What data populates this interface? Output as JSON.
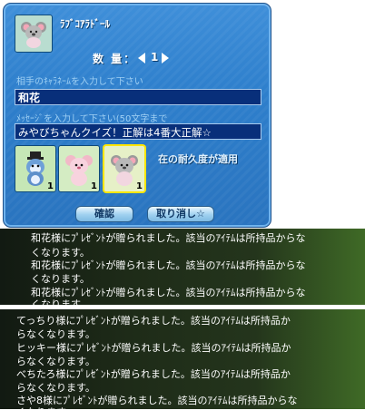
{
  "dialog": {
    "item_name": "ﾗﾌﾞｺｱﾗﾄﾞｰﾙ",
    "quantity_label": "数 量：",
    "quantity_value": "1",
    "hint_recipient": "相手のｷｬﾗﾈｰﾑを入力して下さい",
    "recipient_value": "和花",
    "hint_message": "ﾒｯｾｰｼﾞを入力して下さい(50文字まで",
    "message_value": "みやびちゃんクイズ！正解は4番大正解☆",
    "durability_note": "在の耐久度が適用",
    "slots": [
      {
        "icon": "penguin-doll-icon",
        "count": "1"
      },
      {
        "icon": "koala-doll-icon",
        "count": "1"
      },
      {
        "icon": "koala-doll-icon",
        "count": "1"
      }
    ],
    "confirm_label": "確認",
    "cancel_label": "取り消し☆"
  },
  "chat_log_1": [
    "和花様にﾌﾟﾚｾﾞﾝﾄが贈られました。該当のｱｲﾃﾑは所持品からな",
    "くなります。",
    "和花様にﾌﾟﾚｾﾞﾝﾄが贈られました。該当のｱｲﾃﾑは所持品からな",
    "くなります。",
    "和花様にﾌﾟﾚｾﾞﾝﾄが贈られました。該当のｱｲﾃﾑは所持品からな",
    "くなります。"
  ],
  "chat_log_2": [
    "てっちり様にﾌﾟﾚｾﾞﾝﾄが贈られました。該当のｱｲﾃﾑは所持品か",
    "らなくなります。",
    "ヒッキー様にﾌﾟﾚｾﾞﾝﾄが贈られました。該当のｱｲﾃﾑは所持品か",
    "らなくなります。",
    "べちたろ様にﾌﾟﾚｾﾞﾝﾄが贈られました。該当のｱｲﾃﾑは所持品か",
    "らなくなります。",
    "さや8様にﾌﾟﾚｾﾞﾝﾄが贈られました。該当のｱｲﾃﾑは所持品からな",
    "くなります"
  ]
}
